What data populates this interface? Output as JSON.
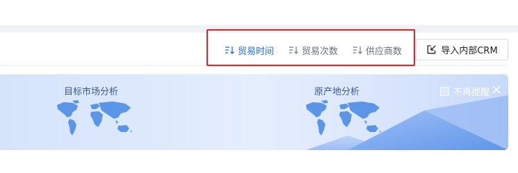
{
  "toolbar": {
    "sort_options": [
      {
        "label": "贸易时间",
        "active": true
      },
      {
        "label": "贸易次数",
        "active": false
      },
      {
        "label": "供应商数",
        "active": false
      }
    ],
    "import_button": {
      "label": "导入内部CRM"
    }
  },
  "banner": {
    "left_title": "目标市场分析",
    "right_title": "原产地分析",
    "dismiss_label": "不再提醒"
  },
  "colors": {
    "accent": "#1f6fdf",
    "highlight": "#e0202b",
    "map": "#5b95e8"
  }
}
